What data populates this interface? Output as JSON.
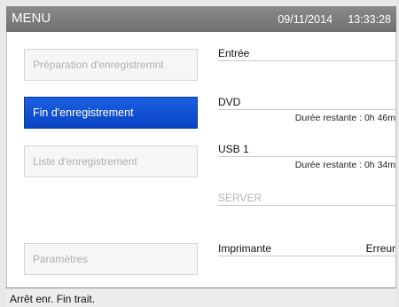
{
  "header": {
    "title": "MENU",
    "date": "09/11/2014",
    "time": "13:33:28"
  },
  "buttons": {
    "prep": "Préparation d'enregistremnt",
    "end": "Fin d'enregistrement",
    "list": "Liste d'enregistrement",
    "params": "Paramètres"
  },
  "info": {
    "entree": "Entrée",
    "dvd": "DVD",
    "dvd_remaining": "Durée restante : 0h 46m",
    "usb": "USB 1",
    "usb_remaining": "Durée restante : 0h 34m",
    "server": "SERVER",
    "printer": "Imprimante",
    "printer_status": "Erreur"
  },
  "status": {
    "text": "Arrêt enr. Fin trait."
  },
  "colors": {
    "active_button": "#0a4ccc",
    "titlebar": "#7c7c7c"
  }
}
